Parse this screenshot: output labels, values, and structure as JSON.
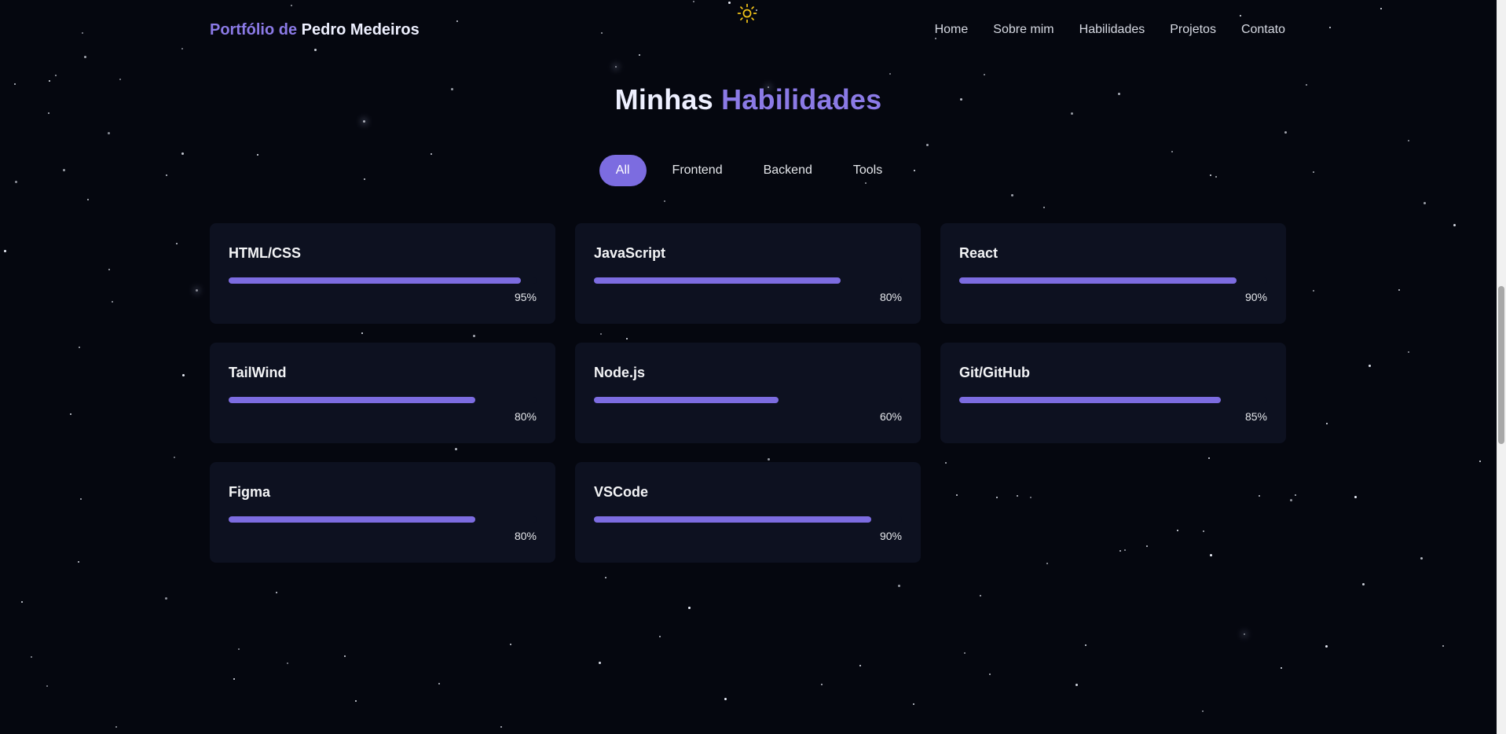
{
  "header": {
    "brand_prefix": "Portfólio de",
    "brand_name": "Pedro Medeiros",
    "theme_toggle_icon": "sun-icon",
    "nav": [
      {
        "label": "Home"
      },
      {
        "label": "Sobre mim"
      },
      {
        "label": "Habilidades"
      },
      {
        "label": "Projetos"
      },
      {
        "label": "Contato"
      }
    ]
  },
  "section": {
    "title_first": "Minhas",
    "title_second": "Habilidades"
  },
  "filters": [
    {
      "label": "All",
      "active": true
    },
    {
      "label": "Frontend",
      "active": false
    },
    {
      "label": "Backend",
      "active": false
    },
    {
      "label": "Tools",
      "active": false
    }
  ],
  "skills": [
    {
      "name": "HTML/CSS",
      "level": 95,
      "level_label": "95%"
    },
    {
      "name": "JavaScript",
      "level": 80,
      "level_label": "80%"
    },
    {
      "name": "React",
      "level": 90,
      "level_label": "90%"
    },
    {
      "name": "TailWind",
      "level": 80,
      "level_label": "80%"
    },
    {
      "name": "Node.js",
      "level": 60,
      "level_label": "60%"
    },
    {
      "name": "Git/GitHub",
      "level": 85,
      "level_label": "85%"
    },
    {
      "name": "Figma",
      "level": 80,
      "level_label": "80%"
    },
    {
      "name": "VSCode",
      "level": 90,
      "level_label": "90%"
    }
  ],
  "colors": {
    "background": "#05070f",
    "accent": "#7c6ce0",
    "accent_text": "#8b7ae6",
    "card": "#0d1120",
    "sun": "#f5c518"
  }
}
